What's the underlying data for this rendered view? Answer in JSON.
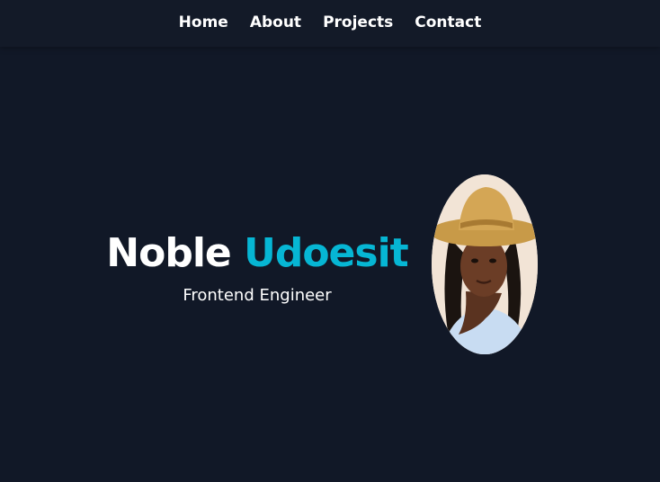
{
  "nav": {
    "items": [
      {
        "label": "Home"
      },
      {
        "label": "About"
      },
      {
        "label": "Projects"
      },
      {
        "label": "Contact"
      }
    ]
  },
  "hero": {
    "first_name": "Noble",
    "last_name": "Udoesit",
    "role": "Frontend Engineer",
    "portrait_icon": "profile-photo"
  },
  "colors": {
    "background": "#111827",
    "navbar": "#131a28",
    "accent": "#06b6d4",
    "text": "#ffffff"
  }
}
